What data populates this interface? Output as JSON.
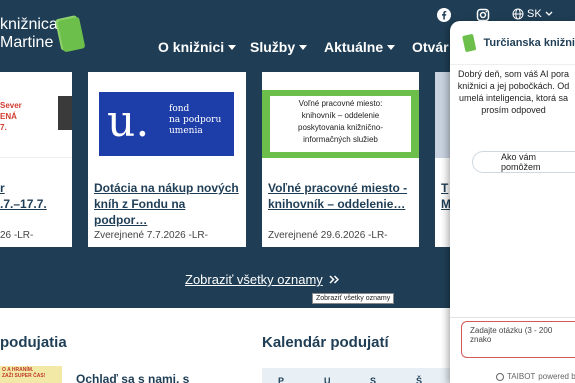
{
  "header": {
    "logo_line1": "knižnica",
    "logo_line2": "Martine",
    "lang": "SK",
    "nav": [
      {
        "label": "O knižnici"
      },
      {
        "label": "Služby"
      },
      {
        "label": "Aktuálne"
      },
      {
        "label": "Otvár"
      }
    ]
  },
  "cards": [
    {
      "thumb_lines": [
        "Sever",
        "ENÁ",
        "7."
      ],
      "title_l1": "r",
      "title_l2": ".7.–17.7.",
      "date": "26 -LR-"
    },
    {
      "thumb_lines": [
        "fond",
        "na podporu",
        "umenia"
      ],
      "title_l1": "Dotácia na nákup nových",
      "title_l2": "kníh z Fondu na podpor…",
      "date": "Zverejnené 7.7.2026 -LR-"
    },
    {
      "thumb_lines": [
        "Voľné pracovné miesto:",
        "knihovník – oddelenie",
        "poskytovania knižnično-",
        "informačných služieb"
      ],
      "title_l1": "Voľné pracovné miesto -",
      "title_l2": "knihovník – oddelenie…",
      "date": "Zverejnené 29.6.2026 -LR-"
    },
    {
      "title_l1": "T",
      "title_l2": "M",
      "date": ""
    }
  ],
  "show_all": "Zobraziť všetky oznamy",
  "tooltip": "Zobraziť všetky oznamy",
  "lower": {
    "events_title": "podujatia",
    "calendar_title": "Kalendár podujatí",
    "promo_lines": [
      "O A HRANÍM.",
      "ZAŽI SUPER ČAS!"
    ],
    "event_title": "Ochlaď sa s nami, s",
    "cal_days": [
      "P",
      "U",
      "S",
      "Š"
    ]
  },
  "chat": {
    "title": "Turčianska knižni",
    "message_lines": [
      "Dobrý deň, som váš AI pora",
      "knižnici a jej pobočkách. Od",
      "umelá inteligencia, ktorá sa",
      "prosím odpoved"
    ],
    "suggestion": "Ako vám pomôžem",
    "input_placeholder": "Zadajte otázku (3 - 200 znako",
    "footer_brand": "TAIBOT",
    "footer_powered": "powered by"
  },
  "colors": {
    "background": "#1f3e55",
    "accent_green": "#6cbf4a",
    "fund_blue": "#1d3ea8",
    "promo_yellow": "#f3e9a6"
  }
}
